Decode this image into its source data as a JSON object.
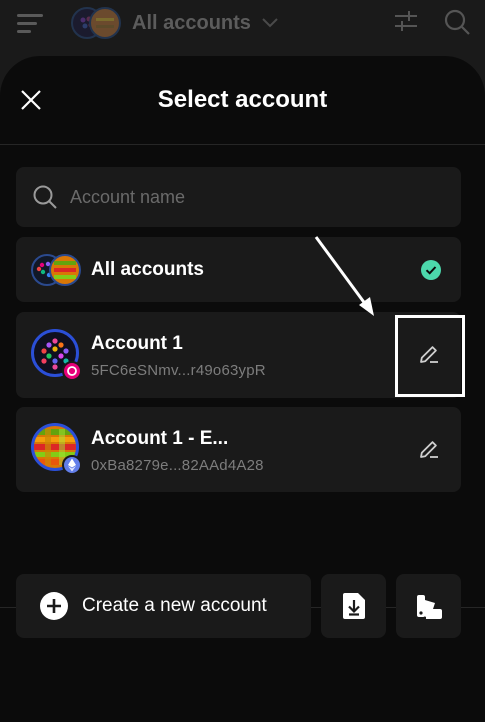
{
  "topbar": {
    "title": "All accounts",
    "icons": [
      "menu-icon",
      "chevron-down-icon",
      "sliders-icon",
      "search-icon"
    ]
  },
  "modal": {
    "title": "Select account",
    "search": {
      "placeholder": "Account name",
      "value": ""
    },
    "accounts": [
      {
        "name": "All accounts",
        "address": "",
        "selected": true
      },
      {
        "name": "Account 1",
        "address": "5FC6eSNmv...r49o63ypR",
        "network_badge": "polkadot-badge-icon",
        "selected": false
      },
      {
        "name": "Account 1 - E...",
        "address": "0xBa8279e...82AAd4A28",
        "network_badge": "ethereum-badge-icon",
        "selected": false
      }
    ],
    "footer": {
      "create_label": "Create a new account",
      "import_icon": "import-icon",
      "theme_icon": "palette-icon"
    }
  },
  "colors": {
    "background": "#0b0b0b",
    "surface": "#1a1a1a",
    "selected_check": "#4cd9ac",
    "muted_text": "#7d7d7d",
    "polkadot_badge": "#e6007a",
    "ethereum_badge": "#627eea"
  }
}
